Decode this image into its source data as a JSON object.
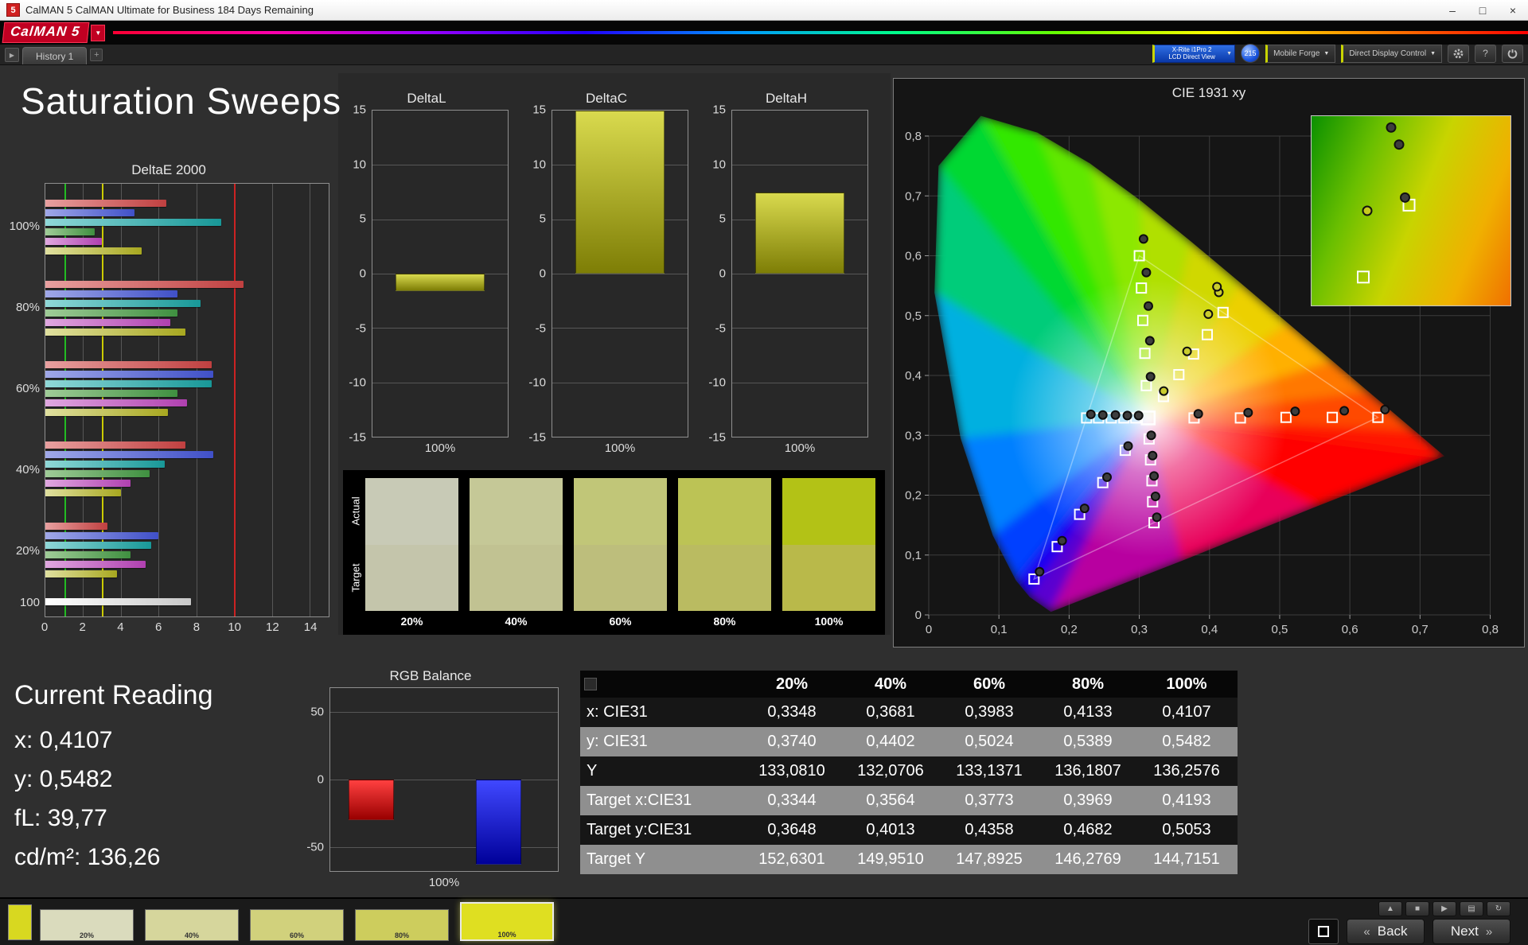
{
  "window": {
    "icon_text": "5",
    "title": "CalMAN 5 CalMAN Ultimate for Business 184 Days Remaining",
    "brand": "CalMAN 5"
  },
  "icons": {
    "minimize": "–",
    "maximize": "□",
    "close": "×",
    "dropdown": "▼",
    "tab_arrow": "▶",
    "add_tab": "+",
    "help": "?",
    "up": "▲",
    "stop": "■",
    "play": "▶",
    "grid": "▤",
    "refresh": "↻",
    "back_chevrons": "«",
    "next_chevrons": "»"
  },
  "tab_bar": {
    "tab": "History 1"
  },
  "toolbar": {
    "meter_line1": "X-Rite i1Pro 2",
    "meter_line2": "LCD Direct View",
    "badge": "215",
    "source": "Mobile Forge",
    "display_control": "Direct Display Control"
  },
  "page": {
    "title": "Saturation Sweeps"
  },
  "chart_data": {
    "deltae": {
      "type": "bar",
      "title": "DeltaE 2000",
      "xmax": 15,
      "xticks": [
        0,
        2,
        4,
        6,
        8,
        10,
        12,
        14
      ],
      "ref_lines": [
        {
          "value": 1,
          "color": "#22bb22"
        },
        {
          "value": 3,
          "color": "#cccc00"
        },
        {
          "value": 10,
          "color": "#cc2222"
        }
      ],
      "groups": [
        {
          "label": "100%",
          "bars": [
            {
              "color": "red",
              "value": 6.4
            },
            {
              "color": "blue",
              "value": 4.7
            },
            {
              "color": "teal",
              "value": 9.3
            },
            {
              "color": "green",
              "value": 2.6
            },
            {
              "color": "magenta",
              "value": 3.0
            },
            {
              "color": "yellow",
              "value": 5.1
            }
          ]
        },
        {
          "label": "80%",
          "bars": [
            {
              "color": "red",
              "value": 10.5
            },
            {
              "color": "blue",
              "value": 7.0
            },
            {
              "color": "teal",
              "value": 8.2
            },
            {
              "color": "green",
              "value": 7.0
            },
            {
              "color": "magenta",
              "value": 6.6
            },
            {
              "color": "yellow",
              "value": 7.4
            }
          ]
        },
        {
          "label": "60%",
          "bars": [
            {
              "color": "red",
              "value": 8.8
            },
            {
              "color": "blue",
              "value": 8.9
            },
            {
              "color": "teal",
              "value": 8.8
            },
            {
              "color": "green",
              "value": 7.0
            },
            {
              "color": "magenta",
              "value": 7.5
            },
            {
              "color": "yellow",
              "value": 6.5
            }
          ]
        },
        {
          "label": "40%",
          "bars": [
            {
              "color": "red",
              "value": 7.4
            },
            {
              "color": "blue",
              "value": 8.9
            },
            {
              "color": "teal",
              "value": 6.3
            },
            {
              "color": "green",
              "value": 5.5
            },
            {
              "color": "magenta",
              "value": 4.5
            },
            {
              "color": "yellow",
              "value": 4.0
            }
          ]
        },
        {
          "label": "20%",
          "bars": [
            {
              "color": "red",
              "value": 3.3
            },
            {
              "color": "blue",
              "value": 6.0
            },
            {
              "color": "teal",
              "value": 5.6
            },
            {
              "color": "green",
              "value": 4.5
            },
            {
              "color": "magenta",
              "value": 5.3
            },
            {
              "color": "yellow",
              "value": 3.8
            }
          ]
        },
        {
          "label": "100",
          "bars": [
            {
              "color": "white",
              "value": 7.7
            }
          ]
        }
      ]
    },
    "delta_charts": [
      {
        "type": "bar",
        "title": "DeltaL",
        "value": -1.6,
        "ymax": 15,
        "yticks": [
          15,
          10,
          5,
          0,
          -5,
          -10,
          -15
        ],
        "xlabel": "100%"
      },
      {
        "type": "bar",
        "title": "DeltaC",
        "value": 15,
        "ymax": 15,
        "yticks": [
          15,
          10,
          5,
          0,
          -5,
          -10,
          -15
        ],
        "xlabel": "100%"
      },
      {
        "type": "bar",
        "title": "DeltaH",
        "value": 7.5,
        "ymax": 15,
        "yticks": [
          15,
          10,
          5,
          0,
          -5,
          -10,
          -15
        ],
        "xlabel": "100%"
      }
    ],
    "cie": {
      "type": "scatter",
      "title": "CIE 1931 xy",
      "xticks": [
        "0",
        "0,1",
        "0,2",
        "0,3",
        "0,4",
        "0,5",
        "0,6",
        "0,7",
        "0,8"
      ],
      "yticks": [
        "0",
        "0,1",
        "0,2",
        "0,3",
        "0,4",
        "0,5",
        "0,6",
        "0,7",
        "0,8"
      ],
      "white_point": [
        0.3127,
        0.329
      ],
      "gamut_triangle": [
        [
          0.64,
          0.33
        ],
        [
          0.3,
          0.6
        ],
        [
          0.15,
          0.06
        ]
      ],
      "targets": [
        {
          "sweep": "red",
          "points": [
            [
              0.378,
              0.329
            ],
            [
              0.444,
              0.329
            ],
            [
              0.509,
              0.33
            ],
            [
              0.575,
              0.33
            ],
            [
              0.64,
              0.33
            ]
          ]
        },
        {
          "sweep": "green",
          "points": [
            [
              0.31,
              0.383
            ],
            [
              0.308,
              0.437
            ],
            [
              0.305,
              0.492
            ],
            [
              0.303,
              0.546
            ],
            [
              0.3,
              0.6
            ]
          ]
        },
        {
          "sweep": "blue",
          "points": [
            [
              0.28,
              0.275
            ],
            [
              0.248,
              0.221
            ],
            [
              0.215,
              0.168
            ],
            [
              0.183,
              0.114
            ],
            [
              0.15,
              0.06
            ]
          ]
        },
        {
          "sweep": "cyan",
          "points": [
            [
              0.295,
              0.329
            ],
            [
              0.278,
              0.329
            ],
            [
              0.26,
              0.329
            ],
            [
              0.242,
              0.329
            ],
            [
              0.225,
              0.329
            ]
          ]
        },
        {
          "sweep": "magenta",
          "points": [
            [
              0.314,
              0.294
            ],
            [
              0.316,
              0.259
            ],
            [
              0.318,
              0.224
            ],
            [
              0.319,
              0.189
            ],
            [
              0.321,
              0.154
            ]
          ]
        },
        {
          "sweep": "yellow",
          "points": [
            [
              0.3344,
              0.3648
            ],
            [
              0.3564,
              0.4013
            ],
            [
              0.3773,
              0.4358
            ],
            [
              0.3969,
              0.4682
            ],
            [
              0.4193,
              0.5053
            ]
          ]
        }
      ],
      "measured": [
        {
          "sweep": "red",
          "color": "#3d3d3d",
          "points": [
            [
              0.384,
              0.336
            ],
            [
              0.455,
              0.338
            ],
            [
              0.522,
              0.34
            ],
            [
              0.592,
              0.341
            ],
            [
              0.65,
              0.343
            ]
          ]
        },
        {
          "sweep": "green",
          "color": "#3d3d3d",
          "points": [
            [
              0.316,
              0.398
            ],
            [
              0.315,
              0.458
            ],
            [
              0.313,
              0.516
            ],
            [
              0.31,
              0.572
            ],
            [
              0.306,
              0.628
            ]
          ]
        },
        {
          "sweep": "blue",
          "color": "#3d3d3d",
          "points": [
            [
              0.284,
              0.282
            ],
            [
              0.254,
              0.23
            ],
            [
              0.222,
              0.178
            ],
            [
              0.19,
              0.124
            ],
            [
              0.158,
              0.072
            ]
          ]
        },
        {
          "sweep": "cyan",
          "color": "#3d3d3d",
          "points": [
            [
              0.299,
              0.333
            ],
            [
              0.283,
              0.333
            ],
            [
              0.266,
              0.334
            ],
            [
              0.248,
              0.334
            ],
            [
              0.231,
              0.335
            ]
          ]
        },
        {
          "sweep": "magenta",
          "color": "#3d3d3d",
          "points": [
            [
              0.317,
              0.3
            ],
            [
              0.319,
              0.266
            ],
            [
              0.321,
              0.232
            ],
            [
              0.323,
              0.198
            ],
            [
              0.325,
              0.163
            ]
          ]
        },
        {
          "sweep": "yellow",
          "color": "#c9cc2e",
          "points": [
            [
              0.3348,
              0.374
            ],
            [
              0.3681,
              0.4402
            ],
            [
              0.3983,
              0.5024
            ],
            [
              0.4133,
              0.5389
            ],
            [
              0.4107,
              0.5482
            ]
          ]
        }
      ],
      "inset": {
        "squares": [
          [
            0.49,
            0.47
          ],
          [
            0.26,
            0.85
          ]
        ],
        "circles": [
          [
            0.4,
            0.06
          ],
          [
            0.44,
            0.15
          ],
          [
            0.28,
            0.5,
            "#c6ca1e"
          ],
          [
            0.47,
            0.43
          ]
        ]
      }
    },
    "rgb_balance": {
      "type": "bar",
      "title": "RGB Balance",
      "ymax": 68,
      "yticks": [
        50,
        0,
        -50
      ],
      "xlabel": "100%",
      "bars": [
        {
          "color": "red",
          "value": -30
        },
        {
          "color": "green",
          "value": 0
        },
        {
          "color": "blue",
          "value": -63
        }
      ]
    }
  },
  "swatches": {
    "row_labels": [
      "Actual",
      "Target"
    ],
    "items": [
      {
        "label": "20%",
        "actual": "#c8cab6",
        "target": "#c4c5ab"
      },
      {
        "label": "40%",
        "actual": "#c5c897",
        "target": "#c1c292"
      },
      {
        "label": "60%",
        "actual": "#c1c678",
        "target": "#bdbe7c"
      },
      {
        "label": "80%",
        "actual": "#bcc355",
        "target": "#babb61"
      },
      {
        "label": "100%",
        "actual": "#b3c216",
        "target": "#b9b94a"
      }
    ]
  },
  "current_reading": {
    "title": "Current Reading",
    "lines": [
      {
        "label": "x:",
        "value": "0,4107"
      },
      {
        "label": "y:",
        "value": "0,5482"
      },
      {
        "label": "fL:",
        "value": "39,77"
      },
      {
        "label": "cd/m²:",
        "value": "136,26"
      }
    ]
  },
  "table": {
    "columns": [
      "20%",
      "40%",
      "60%",
      "80%",
      "100%"
    ],
    "rows": [
      {
        "label": "x: CIE31",
        "values": [
          "0,3348",
          "0,3681",
          "0,3983",
          "0,4133",
          "0,4107"
        ]
      },
      {
        "label": "y: CIE31",
        "values": [
          "0,3740",
          "0,4402",
          "0,5024",
          "0,5389",
          "0,5482"
        ]
      },
      {
        "label": "Y",
        "values": [
          "133,0810",
          "132,0706",
          "133,1371",
          "136,1807",
          "136,2576"
        ]
      },
      {
        "label": "Target x:CIE31",
        "values": [
          "0,3344",
          "0,3564",
          "0,3773",
          "0,3969",
          "0,4193"
        ]
      },
      {
        "label": "Target y:CIE31",
        "values": [
          "0,3648",
          "0,4013",
          "0,4358",
          "0,4682",
          "0,5053"
        ]
      },
      {
        "label": "Target Y",
        "values": [
          "152,6301",
          "149,9510",
          "147,8925",
          "146,2769",
          "144,7151"
        ]
      }
    ]
  },
  "bottom_bar": {
    "active_color": "#d8d820",
    "swatches": [
      {
        "label": "20%",
        "color": "#dadbbd",
        "selected": false
      },
      {
        "label": "40%",
        "color": "#d6d69c",
        "selected": false
      },
      {
        "label": "60%",
        "color": "#d1d17c",
        "selected": false
      },
      {
        "label": "80%",
        "color": "#cdcd5d",
        "selected": false
      },
      {
        "label": "100%",
        "color": "#dfdf21",
        "selected": true
      }
    ],
    "back_label": "Back",
    "next_label": "Next"
  }
}
